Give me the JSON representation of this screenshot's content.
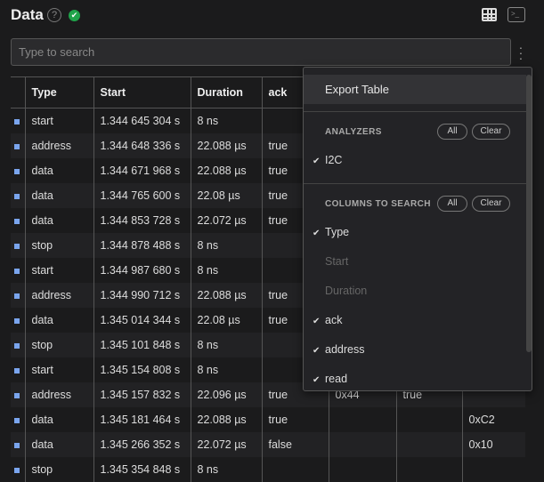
{
  "header": {
    "title": "Data",
    "help": "?",
    "status": "ok"
  },
  "search": {
    "placeholder": "Type to search",
    "value": ""
  },
  "table": {
    "columns": [
      "Type",
      "Start",
      "Duration",
      "ack",
      "",
      "",
      ""
    ],
    "rows": [
      [
        "start",
        "1.344 645 304 s",
        "8 ns",
        "",
        "",
        "",
        ""
      ],
      [
        "address",
        "1.344 648 336 s",
        "22.088 µs",
        "true",
        "",
        "",
        ""
      ],
      [
        "data",
        "1.344 671 968 s",
        "22.088 µs",
        "true",
        "",
        "",
        ""
      ],
      [
        "data",
        "1.344 765 600 s",
        "22.08 µs",
        "true",
        "",
        "",
        ""
      ],
      [
        "data",
        "1.344 853 728 s",
        "22.072 µs",
        "true",
        "",
        "",
        ""
      ],
      [
        "stop",
        "1.344 878 488 s",
        "8 ns",
        "",
        "",
        "",
        ""
      ],
      [
        "start",
        "1.344 987 680 s",
        "8 ns",
        "",
        "",
        "",
        ""
      ],
      [
        "address",
        "1.344 990 712 s",
        "22.088 µs",
        "true",
        "",
        "",
        ""
      ],
      [
        "data",
        "1.345 014 344 s",
        "22.08 µs",
        "true",
        "",
        "",
        ""
      ],
      [
        "stop",
        "1.345 101 848 s",
        "8 ns",
        "",
        "",
        "",
        ""
      ],
      [
        "start",
        "1.345 154 808 s",
        "8 ns",
        "",
        "",
        "",
        ""
      ],
      [
        "address",
        "1.345 157 832 s",
        "22.096 µs",
        "true",
        "0x44",
        "true",
        ""
      ],
      [
        "data",
        "1.345 181 464 s",
        "22.088 µs",
        "true",
        "",
        "",
        "0xC2"
      ],
      [
        "data",
        "1.345 266 352 s",
        "22.072 µs",
        "false",
        "",
        "",
        "0x10"
      ],
      [
        "stop",
        "1.345 354 848 s",
        "8 ns",
        "",
        "",
        "",
        ""
      ]
    ]
  },
  "menu": {
    "export": "Export Table",
    "analyzers_title": "ANALYZERS",
    "all": "All",
    "clear": "Clear",
    "analyzers": [
      {
        "label": "I2C",
        "checked": true
      }
    ],
    "columns_title": "COLUMNS TO SEARCH",
    "columns": [
      {
        "label": "Type",
        "checked": true
      },
      {
        "label": "Start",
        "checked": false
      },
      {
        "label": "Duration",
        "checked": false
      },
      {
        "label": "ack",
        "checked": true
      },
      {
        "label": "address",
        "checked": true
      },
      {
        "label": "read",
        "checked": true
      }
    ]
  },
  "colors": {
    "marker": "#7aa5ee",
    "status": "#1fa34a"
  }
}
